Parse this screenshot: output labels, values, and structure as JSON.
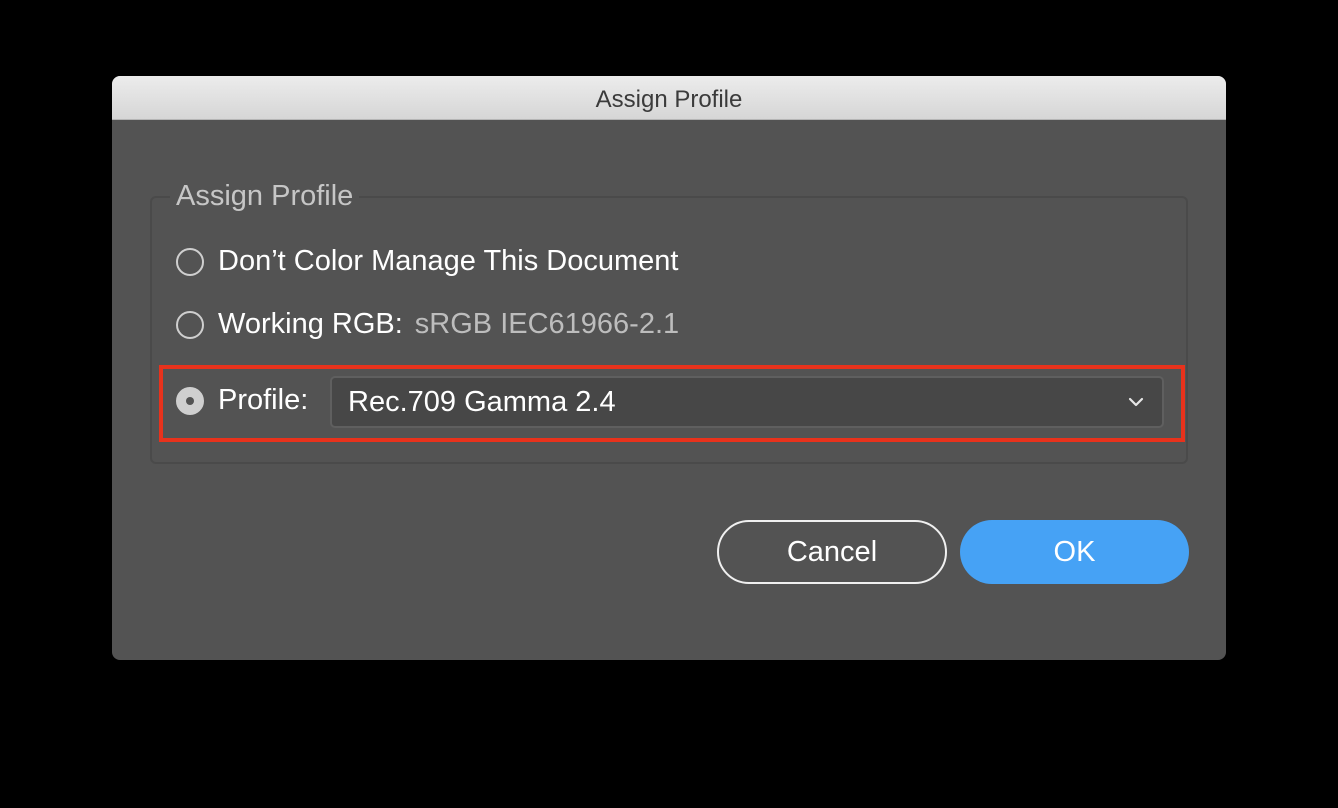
{
  "dialog": {
    "title": "Assign Profile",
    "group_label": "Assign Profile",
    "options": {
      "dont_manage": {
        "label": "Don’t Color Manage This Document",
        "selected": false
      },
      "working_rgb": {
        "label": "Working RGB:",
        "value": "sRGB IEC61966-2.1",
        "selected": false
      },
      "profile": {
        "label": "Profile:",
        "selected": true
      }
    },
    "profile_select": {
      "value": "Rec.709 Gamma 2.4",
      "icon": "chevron-down-icon"
    },
    "buttons": {
      "cancel": "Cancel",
      "ok": "OK"
    }
  },
  "colors": {
    "dialog_bg": "#535353",
    "accent_button": "#46a2f5",
    "highlight_border": "#e8321c"
  }
}
